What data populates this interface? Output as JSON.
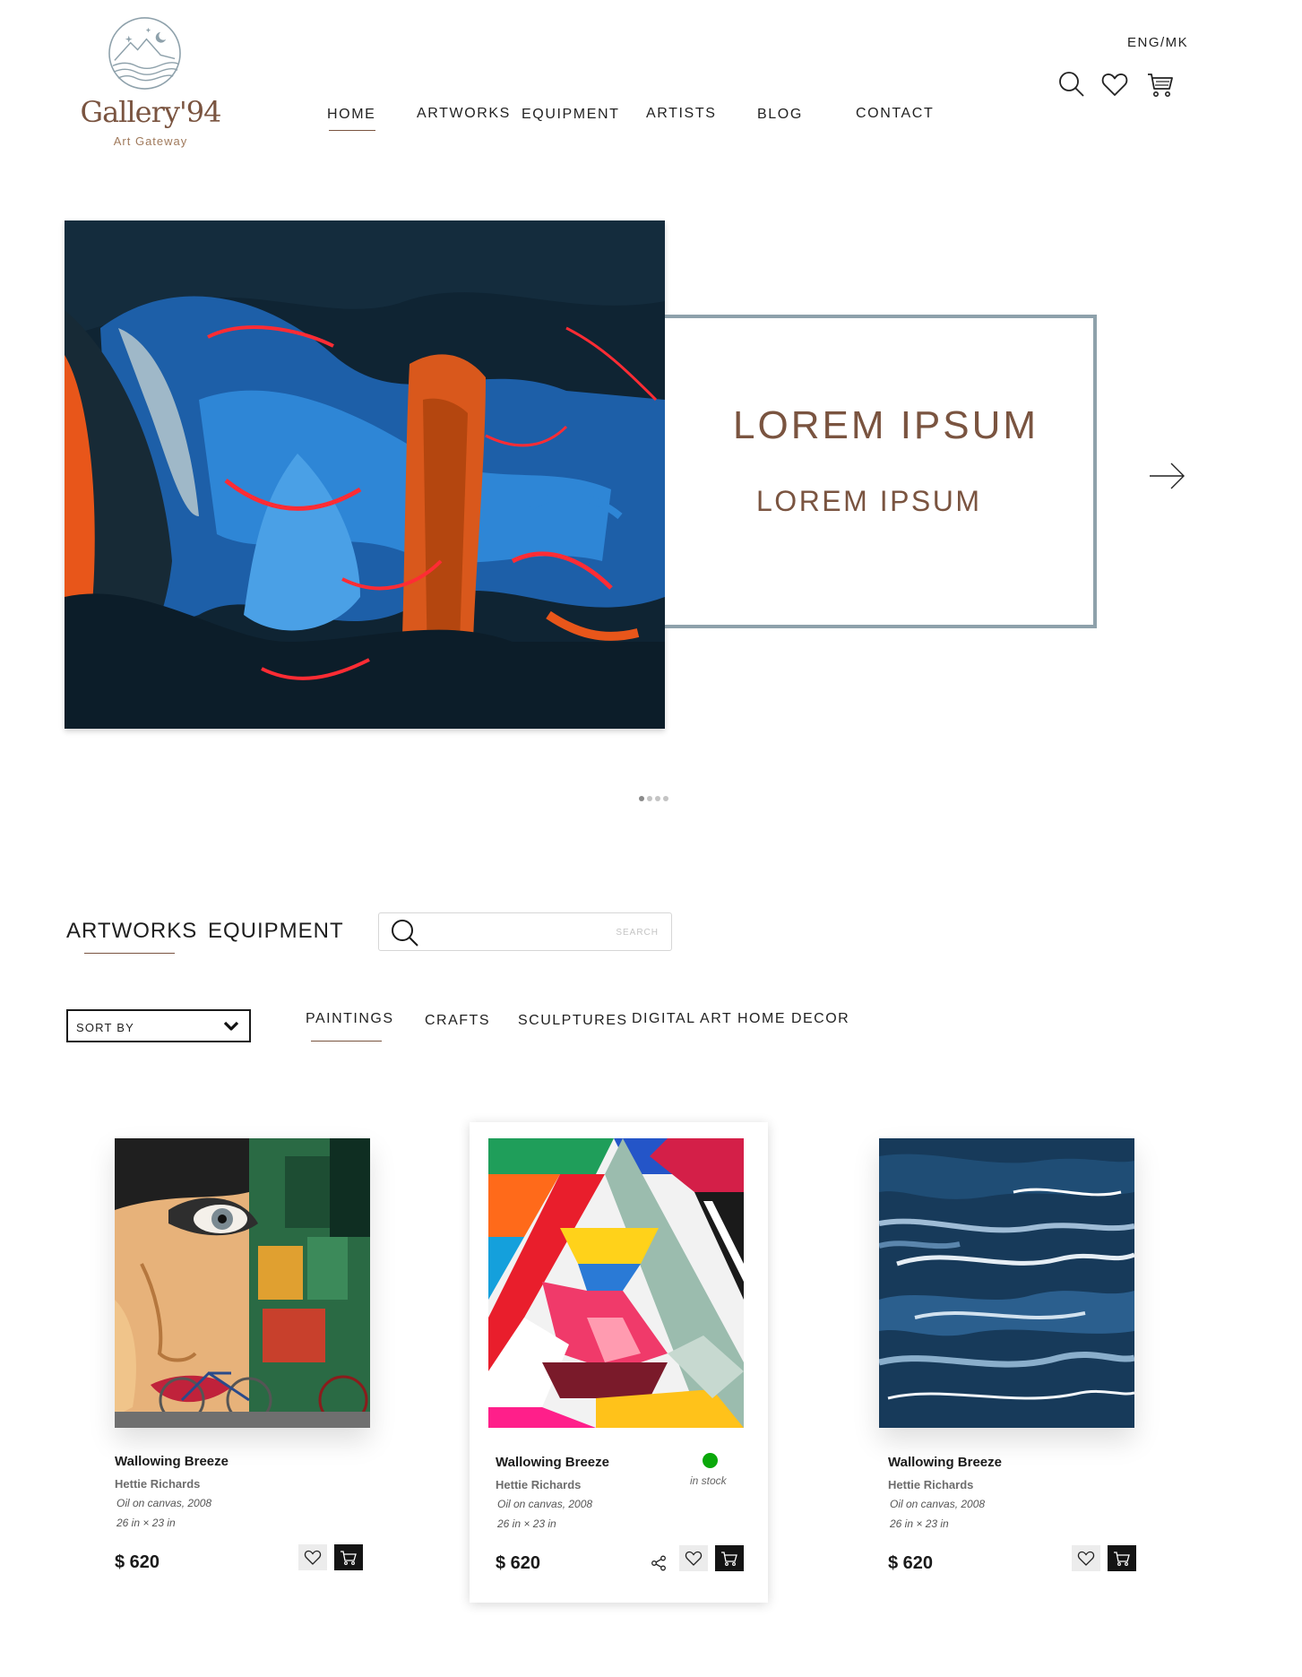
{
  "brand": {
    "name": "Gallery'94",
    "tagline": "Art Gateway"
  },
  "header": {
    "nav": [
      "HOME",
      "ARTWORKS",
      "EQUIPMENT",
      "ARTISTS",
      "BLOG",
      "CONTACT"
    ],
    "active_nav": "HOME",
    "language": "ENG/MK",
    "icons": [
      "search-icon",
      "heart-icon",
      "cart-icon"
    ]
  },
  "hero": {
    "title": "LOREM IPSUM",
    "subtitle": "LOREM IPSUM",
    "slide_count": 4,
    "active_slide": 1,
    "border_color": "#8ea1ab",
    "text_color": "#7a5440"
  },
  "catalog": {
    "tabs": [
      "ARTWORKS",
      "EQUIPMENT"
    ],
    "active_tab": "ARTWORKS",
    "search_placeholder": "SEARCH",
    "sort_label": "SORT BY",
    "categories": [
      "PAINTINGS",
      "CRAFTS",
      "SCULPTURES",
      "DIGITAL ART",
      "HOME DECOR"
    ],
    "active_category": "PAINTINGS"
  },
  "products": [
    {
      "title": "Wallowing Breeze",
      "artist": "Hettie Richards",
      "medium": "Oil on canvas, 2008",
      "dimensions": "26 in × 23 in",
      "price": "$ 620"
    },
    {
      "title": "Wallowing Breeze",
      "artist": "Hettie Richards",
      "medium": "Oil on canvas, 2008",
      "dimensions": "26 in × 23 in",
      "price": "$ 620",
      "stock": "in stock",
      "stock_color": "#0aa80a"
    },
    {
      "title": "Wallowing Breeze",
      "artist": "Hettie Richards",
      "medium": "Oil on canvas, 2008",
      "dimensions": "26 in × 23 in",
      "price": "$ 620"
    }
  ]
}
